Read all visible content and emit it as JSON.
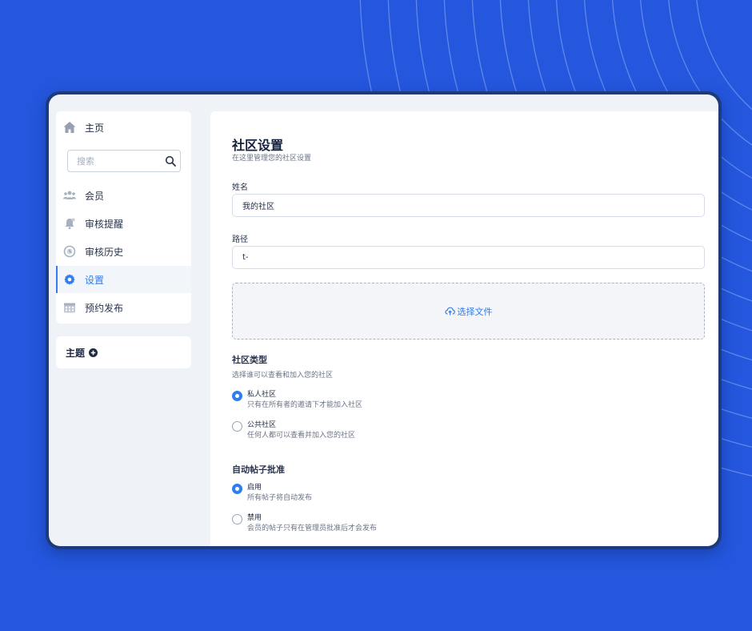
{
  "colors": {
    "background": "#2457de",
    "accent": "#2f7df0",
    "frame": "#1e3a78",
    "panel": "#ffffff",
    "app_bg": "#eff3f8"
  },
  "sidebar": {
    "home": {
      "label": "主页",
      "icon": "home-icon"
    },
    "search": {
      "placeholder": "搜索",
      "icon": "search-icon"
    },
    "items": [
      {
        "label": "会员",
        "icon": "members-icon",
        "active": false
      },
      {
        "label": "审核提醒",
        "icon": "bell-icon",
        "active": false
      },
      {
        "label": "审核历史",
        "icon": "history-icon",
        "active": false
      },
      {
        "label": "设置",
        "icon": "gear-icon",
        "active": true
      },
      {
        "label": "预约发布",
        "icon": "calendar-icon",
        "active": false
      }
    ],
    "topics": {
      "label": "主题",
      "icon": "plus-circle-icon"
    }
  },
  "settings": {
    "title": "社区设置",
    "subtitle": "在这里管理您的社区设置",
    "name": {
      "label": "姓名",
      "value": "我的社区"
    },
    "path": {
      "label": "路径",
      "value": "t-"
    },
    "upload": {
      "label": "选择文件",
      "icon": "upload-cloud-icon"
    },
    "community_type": {
      "title": "社区类型",
      "description": "选择谁可以查看和加入您的社区",
      "options": [
        {
          "title": "私人社区",
          "description": "只有在所有者的邀请下才能加入社区",
          "checked": true
        },
        {
          "title": "公共社区",
          "description": "任何人都可以查看并加入您的社区",
          "checked": false
        }
      ]
    },
    "auto_approve": {
      "title": "自动帖子批准",
      "options": [
        {
          "title": "启用",
          "description": "所有帖子将自动发布",
          "checked": true
        },
        {
          "title": "禁用",
          "description": "会员的帖子只有在管理员批准后才会发布",
          "checked": false
        }
      ]
    }
  }
}
